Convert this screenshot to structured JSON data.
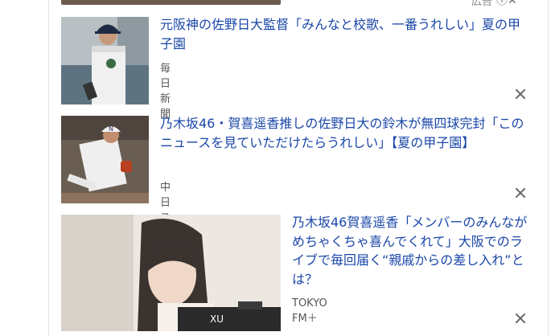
{
  "ad": {
    "label": "広告",
    "icons": [
      "info-icon",
      "close-icon"
    ]
  },
  "articles": [
    {
      "title": "元阪神の佐野日大監督「みんなと校歌、一番うれしい」夏の甲子園",
      "source": "毎日新聞"
    },
    {
      "title": "乃木坂46・賀喜遥香推しの佐野日大の鈴木が無四球完封「このニュースを見ていただけたらうれしい」【夏の甲子園】",
      "source": "中日スポーツ"
    },
    {
      "title": "乃木坂46賀喜遥香「メンバーのみんながめちゃくちゃ喜んでくれて」大阪でのライブで毎回届く“親戚からの差し入れ”とは？",
      "source": "TOKYO FM＋"
    }
  ]
}
